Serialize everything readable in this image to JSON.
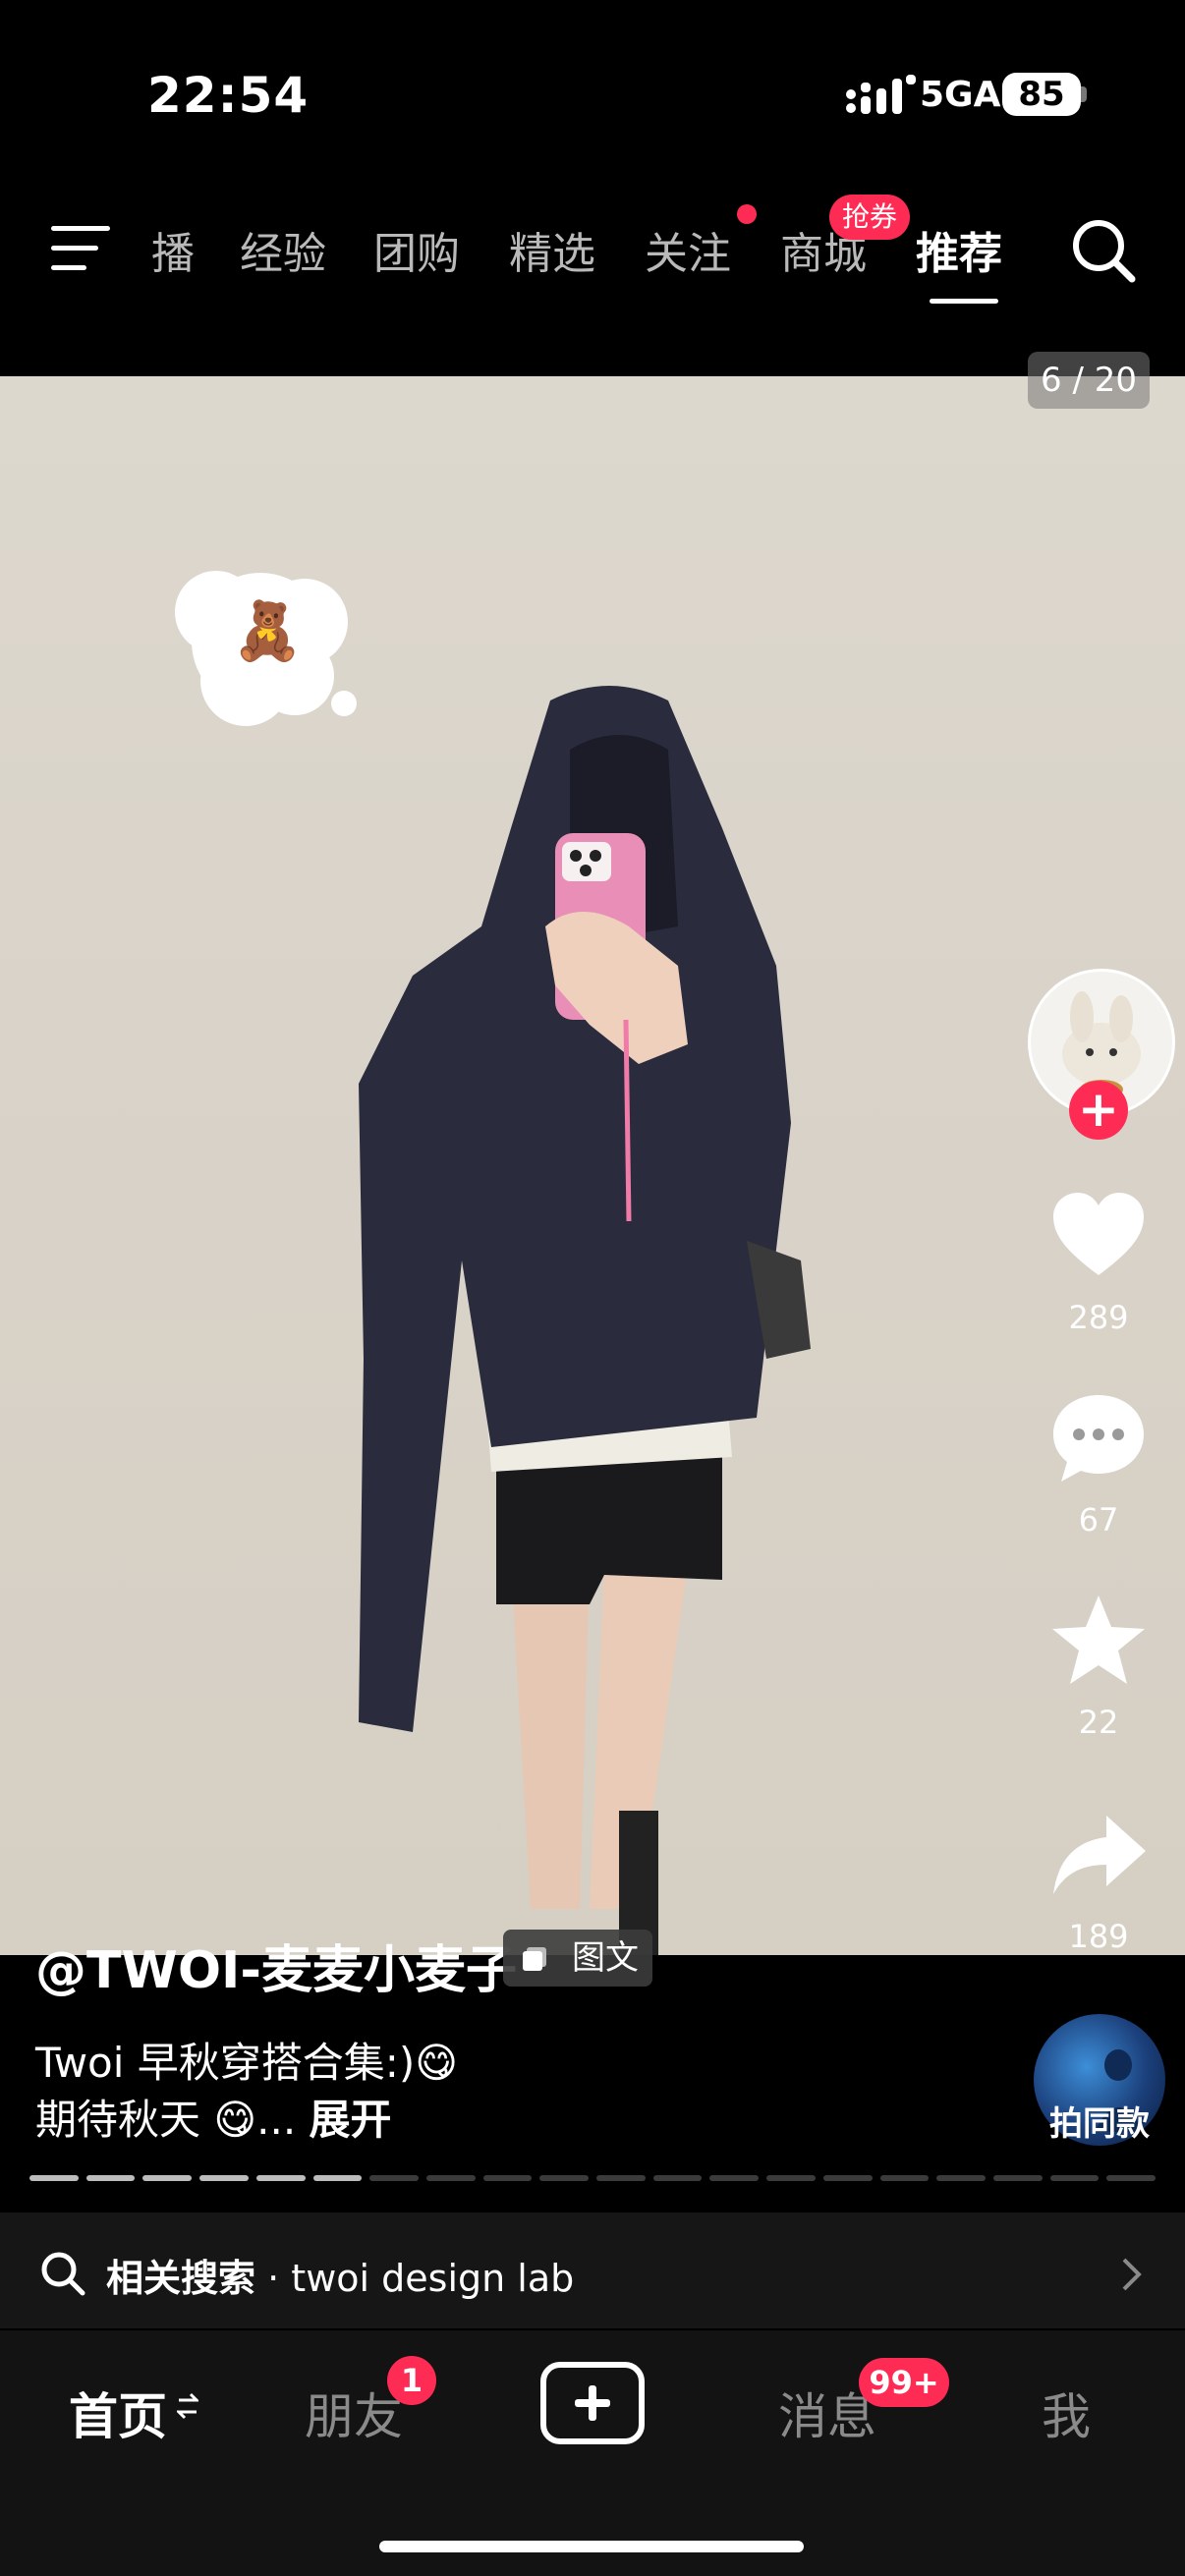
{
  "status_bar": {
    "time": "22:54",
    "network": "5GA",
    "battery": "85"
  },
  "top_nav": {
    "tabs": [
      "播",
      "经验",
      "团购",
      "精选",
      "关注",
      "商城",
      "推荐"
    ],
    "active_tab": "推荐",
    "coupon_badge": "抢券"
  },
  "post": {
    "image_counter": "6 / 20",
    "author": "@TWOI-麦麦小麦子",
    "type_tag": "图文",
    "caption_line1": "Twoi 早秋穿搭合集:)😋",
    "caption_line2": "期待秋天 😋...",
    "expand_label": "展开",
    "sticker_emoji": "🧸",
    "progress_total": 20,
    "progress_filled": 6
  },
  "actions": {
    "likes": "289",
    "comments": "67",
    "favorites": "22",
    "shares": "189",
    "same_style_label": "拍同款"
  },
  "related_search": {
    "prefix": "相关搜索",
    "separator": "·",
    "query": "twoi design lab"
  },
  "bottom_nav": {
    "home": "首页",
    "friends": "朋友",
    "friends_badge": "1",
    "messages": "消息",
    "messages_badge": "99+",
    "me": "我"
  },
  "colors": {
    "accent": "#fe2c55",
    "background": "#000000"
  }
}
